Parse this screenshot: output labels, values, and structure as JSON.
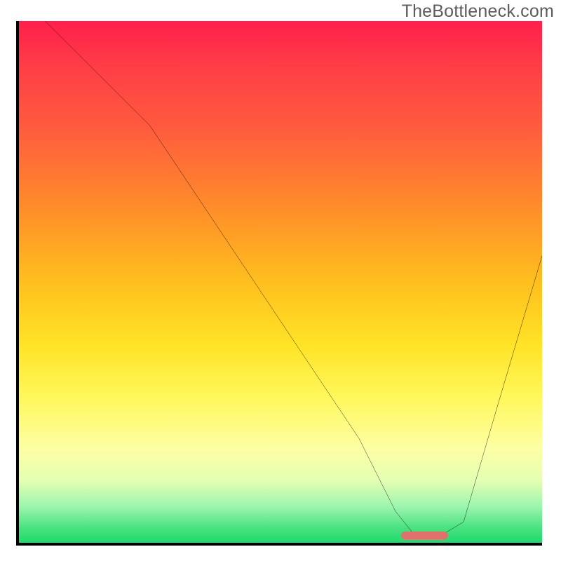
{
  "watermark": "TheBottleneck.com",
  "colors": {
    "curve": "#000000",
    "marker": "#e2706c",
    "axis": "#000000"
  },
  "chart_data": {
    "type": "line",
    "title": "",
    "xlabel": "",
    "ylabel": "",
    "xlim": [
      0,
      100
    ],
    "ylim": [
      0,
      100
    ],
    "x": [
      5,
      15,
      25,
      35,
      45,
      55,
      65,
      72,
      76,
      80,
      85,
      92,
      100
    ],
    "y": [
      100,
      90,
      80,
      65,
      50,
      35,
      20,
      6,
      1,
      1,
      4,
      28,
      55
    ],
    "marker": {
      "x_start": 73,
      "x_end": 82,
      "y": 0.7
    },
    "note": "x/y in 0–100 chart-space; y=0 is bottom (no bottleneck), y=100 is top (max bottleneck). Values estimated from pixels."
  }
}
